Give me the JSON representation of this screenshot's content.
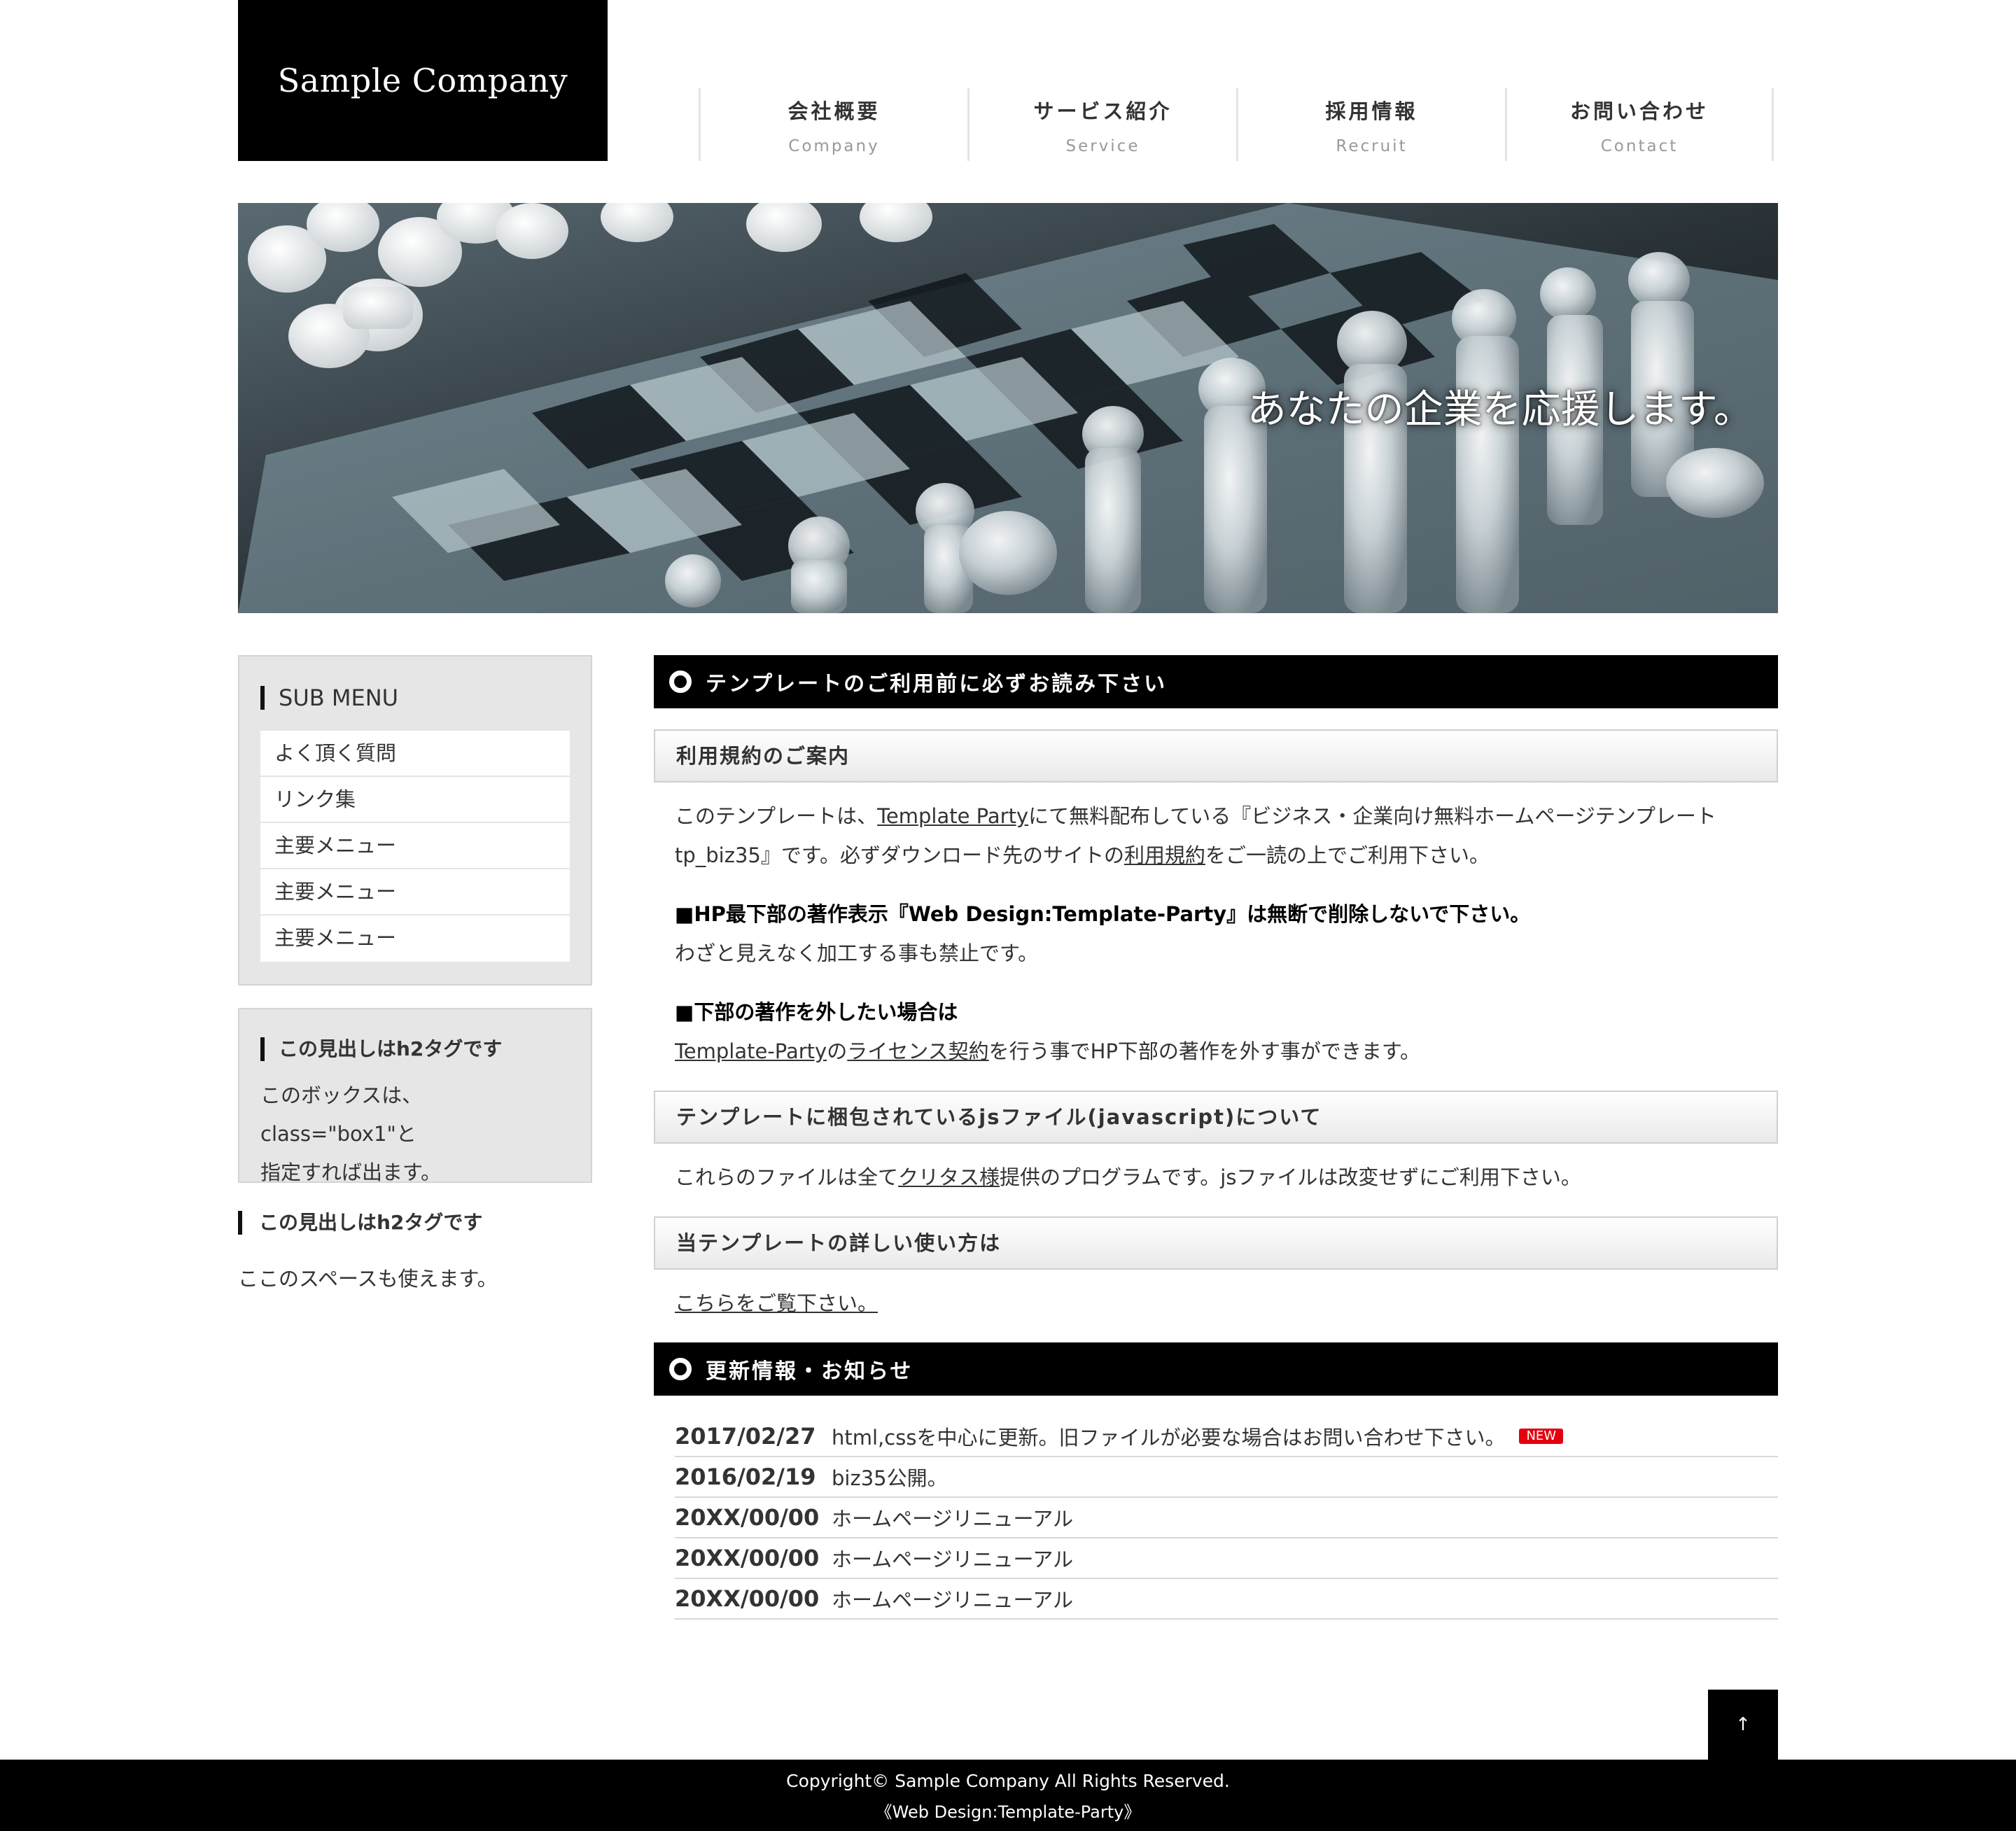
{
  "header": {
    "logo": "Sample Company",
    "nav": [
      {
        "jp": "会社概要",
        "en": "Company"
      },
      {
        "jp": "サービス紹介",
        "en": "Service"
      },
      {
        "jp": "採用情報",
        "en": "Recruit"
      },
      {
        "jp": "お問い合わせ",
        "en": "Contact"
      }
    ]
  },
  "hero": {
    "caption": "あなたの企業を応援します。"
  },
  "sidebar": {
    "submenu_title": "SUB MENU",
    "submenu": [
      "よく頂く質問",
      "リンク集",
      "主要メニュー",
      "主要メニュー",
      "主要メニュー"
    ],
    "box1": {
      "title": "この見出しはh2タグです",
      "text_line1": "このボックスは、class=\"box1\"と",
      "text_line2": "指定すれば出ます。"
    },
    "plain": {
      "title": "この見出しはh2タグです",
      "text": "ここのスペースも使えます。"
    }
  },
  "main": {
    "h2_notice": "テンプレートのご利用前に必ずお読み下さい",
    "h3_terms": "利用規約のご案内",
    "p1_part1": "このテンプレートは、",
    "p1_link1": "Template Party",
    "p1_part2": "にて無料配布している『ビジネス・企業向け無料ホームページテンプレート",
    "p1_part3": "tp_biz35』です。必ずダウンロード先のサイトの",
    "p1_link2": "利用規約",
    "p1_part4": "をご一読の上でご利用下さい。",
    "p2_strong": "■HP最下部の著作表示『Web Design:Template-Party』は無断で削除しないで下さい。",
    "p2_text": "わざと見えなく加工する事も禁止です。",
    "p3_strong": "■下部の著作を外したい場合は",
    "p3_link1": "Template-Party",
    "p3_part1": "の",
    "p3_link2": "ライセンス契約",
    "p3_part2": "を行う事でHP下部の著作を外す事ができます。",
    "h3_js": "テンプレートに梱包されているjsファイル(javascript)について",
    "p4_part1": "これらのファイルは全て",
    "p4_link": "クリタス様",
    "p4_part2": "提供のプログラムです。jsファイルは改変せずにご利用下さい。",
    "h3_howto": "当テンプレートの詳しい使い方は",
    "p5_link": "こちらをご覧下さい。",
    "h2_news": "更新情報・お知らせ"
  },
  "news": [
    {
      "date": "2017/02/27",
      "text": "html,cssを中心に更新。旧ファイルが必要な場合はお問い合わせ下さい。",
      "badge": "NEW"
    },
    {
      "date": "2016/02/19",
      "text": "biz35公開。"
    },
    {
      "date": "20XX/00/00",
      "text": "ホームページリニューアル"
    },
    {
      "date": "20XX/00/00",
      "text": "ホームページリニューアル"
    },
    {
      "date": "20XX/00/00",
      "text": "ホームページリニューアル"
    }
  ],
  "pagetop": "↑",
  "footer": {
    "copyright": "Copyright© Sample Company All Rights Reserved.",
    "credit": "《Web Design:Template-Party》"
  },
  "colors": {
    "accent": "#000000",
    "new_badge": "#e4000f"
  }
}
